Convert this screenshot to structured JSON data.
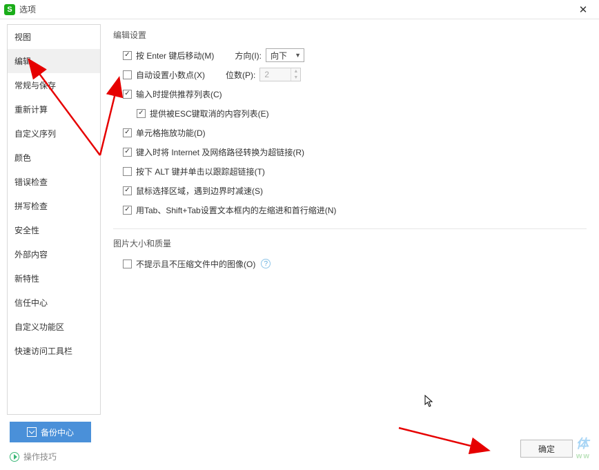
{
  "title": "选项",
  "sidebar": {
    "items": [
      {
        "label": "视图"
      },
      {
        "label": "编辑"
      },
      {
        "label": "常规与保存"
      },
      {
        "label": "重新计算"
      },
      {
        "label": "自定义序列"
      },
      {
        "label": "颜色"
      },
      {
        "label": "错误检查"
      },
      {
        "label": "拼写检查"
      },
      {
        "label": "安全性"
      },
      {
        "label": "外部内容"
      },
      {
        "label": "新特性"
      },
      {
        "label": "信任中心"
      },
      {
        "label": "自定义功能区"
      },
      {
        "label": "快速访问工具栏"
      }
    ],
    "selected_index": 1
  },
  "sections": {
    "edit_settings": {
      "title": "编辑设置",
      "items": {
        "enter_move": {
          "label": "按 Enter 键后移动(M)",
          "checked": true
        },
        "direction": {
          "label": "方向(I):",
          "value": "向下"
        },
        "auto_decimal": {
          "label": "自动设置小数点(X)",
          "checked": false
        },
        "places": {
          "label": "位数(P):",
          "value": "2"
        },
        "recommend_list": {
          "label": "输入时提供推荐列表(C)",
          "checked": true
        },
        "esc_list": {
          "label": "提供被ESC键取消的内容列表(E)",
          "checked": true
        },
        "drag_zoom": {
          "label": "单元格拖放功能(D)",
          "checked": true
        },
        "hyperlink_convert": {
          "label": "键入时将 Internet 及网络路径转换为超链接(R)",
          "checked": true
        },
        "alt_click": {
          "label": "按下 ALT 键并单击以跟踪超链接(T)",
          "checked": false
        },
        "mouse_select": {
          "label": "鼠标选择区域，遇到边界时减速(S)",
          "checked": true
        },
        "tab_indent": {
          "label": "用Tab、Shift+Tab设置文本框内的左缩进和首行缩进(N)",
          "checked": true
        }
      }
    },
    "image_quality": {
      "title": "图片大小和质量",
      "items": {
        "no_compress": {
          "label": "不提示且不压缩文件中的图像(O)",
          "checked": false
        }
      }
    }
  },
  "footer": {
    "backup_label": "备份中心",
    "tips_label": "操作技巧",
    "ok_label": "确定"
  },
  "watermark": {
    "main": "体",
    "sub": "ww"
  }
}
